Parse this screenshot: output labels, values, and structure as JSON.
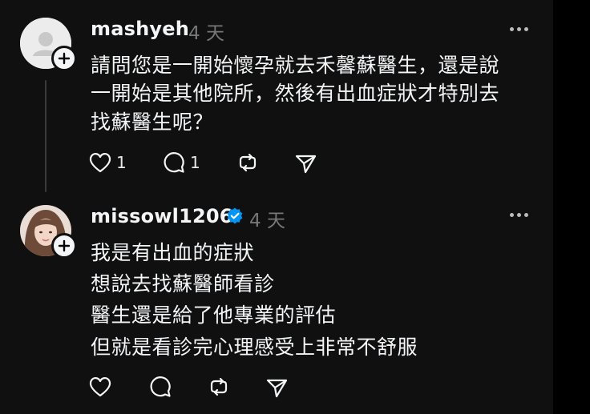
{
  "comments": [
    {
      "username": "mashyeh",
      "time": "4 天",
      "verified": false,
      "lines": [
        "請問您是一開始懷孕就去禾馨蘇醫生，還是說",
        "一開始是其他院所，然後有出血症狀才特別去",
        "找蘇醫生呢？"
      ],
      "likes": "1",
      "replies": "1"
    },
    {
      "username": "missowl1206",
      "time": "4 天",
      "verified": true,
      "lines": [
        "我是有出血的症狀",
        "想說去找蘇醫師看診",
        "醫生還是給了他專業的評估",
        "但就是看診完心理感受上非常不舒服"
      ],
      "likes": "",
      "replies": ""
    }
  ],
  "icons": {
    "like": "heart-icon",
    "reply": "comment-bubble-icon",
    "repost": "repost-icon",
    "share": "send-icon",
    "more": "more-options-icon",
    "follow": "plus-icon",
    "verified": "verified-badge-icon"
  },
  "colors": {
    "background": "#101010",
    "text": "#f3f5f7",
    "secondary": "#777777",
    "verified": "#0095f6"
  }
}
